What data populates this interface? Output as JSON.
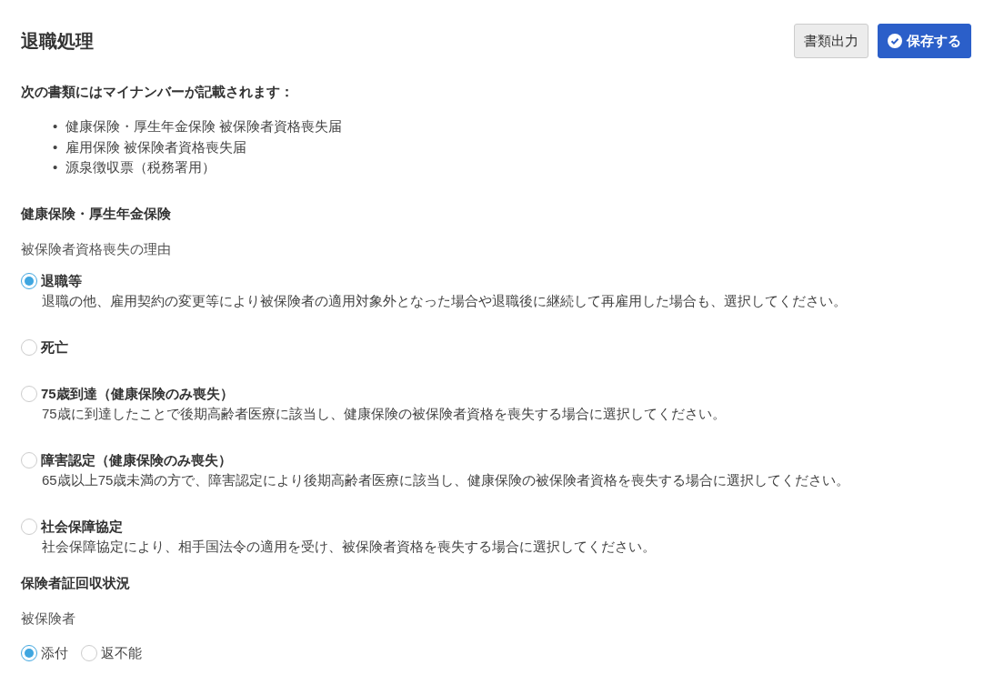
{
  "title": "退職処理",
  "buttons": [
    {
      "label": "書類出力",
      "kind": "secondary"
    },
    {
      "label": "保存する",
      "kind": "primary"
    }
  ],
  "notice": {
    "heading": "次の書類にはマイナンバーが記載されます：",
    "items": [
      {
        "marker": "•",
        "text": "健康保険・厚生年金保険 被保険者資格喪失届"
      },
      {
        "marker": "•",
        "text": "雇用保険 被保険者資格喪失届"
      },
      {
        "marker": "•",
        "text": "源泉徴収票（税務署用）"
      }
    ]
  },
  "insurance_section": {
    "heading": "健康保険・厚生年金保険",
    "field_label": "被保険者資格喪失の理由",
    "options": [
      {
        "label": "退職等",
        "description": "退職の他、雇用契約の変更等により被保険者の適用対象外となった場合や退職後に継続して再雇用した場合も、選択してください。",
        "selected": true
      },
      {
        "label": "死亡",
        "selected": false
      },
      {
        "label": "75歳到達（健康保険のみ喪失）",
        "description": "75歳に到達したことで後期高齢者医療に該当し、健康保険の被保険者資格を喪失する場合に選択してください。",
        "selected": false
      },
      {
        "label": "障害認定（健康保険のみ喪失）",
        "description": "65歳以上75歳未満の方で、障害認定により後期高齢者医療に該当し、健康保険の被保険者資格を喪失する場合に選択してください。",
        "selected": false
      },
      {
        "label": "社会保障協定",
        "description": "社会保障協定により、相手国法令の適用を受け、被保険者資格を喪失する場合に選択してください。",
        "selected": false
      }
    ]
  },
  "card_section": {
    "heading": "保険者証回収状況",
    "field_label": "被保険者",
    "options": [
      {
        "label": "添付",
        "selected": true
      },
      {
        "label": "返不能",
        "selected": false
      }
    ]
  }
}
